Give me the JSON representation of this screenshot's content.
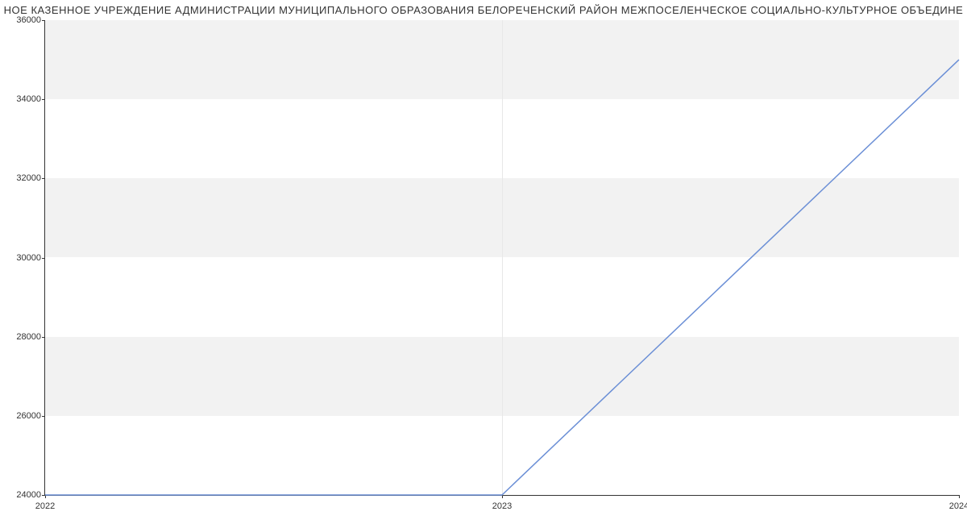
{
  "chart_data": {
    "type": "line",
    "title": "НОЕ КАЗЕННОЕ УЧРЕЖДЕНИЕ АДМИНИСТРАЦИИ МУНИЦИПАЛЬНОГО ОБРАЗОВАНИЯ БЕЛОРЕЧЕНСКИЙ РАЙОН МЕЖПОСЕЛЕНЧЕСКОЕ СОЦИАЛЬНО-КУЛЬТУРНОЕ ОБЪЕДИНЕ",
    "x": [
      2022,
      2023,
      2024
    ],
    "values": [
      24000,
      24000,
      35000
    ],
    "xlabel": "",
    "ylabel": "",
    "ylim": [
      24000,
      36000
    ],
    "xlim": [
      2022,
      2024
    ],
    "y_ticks": [
      24000,
      26000,
      28000,
      30000,
      32000,
      34000,
      36000
    ],
    "x_ticks": [
      2022,
      2023,
      2024
    ]
  }
}
